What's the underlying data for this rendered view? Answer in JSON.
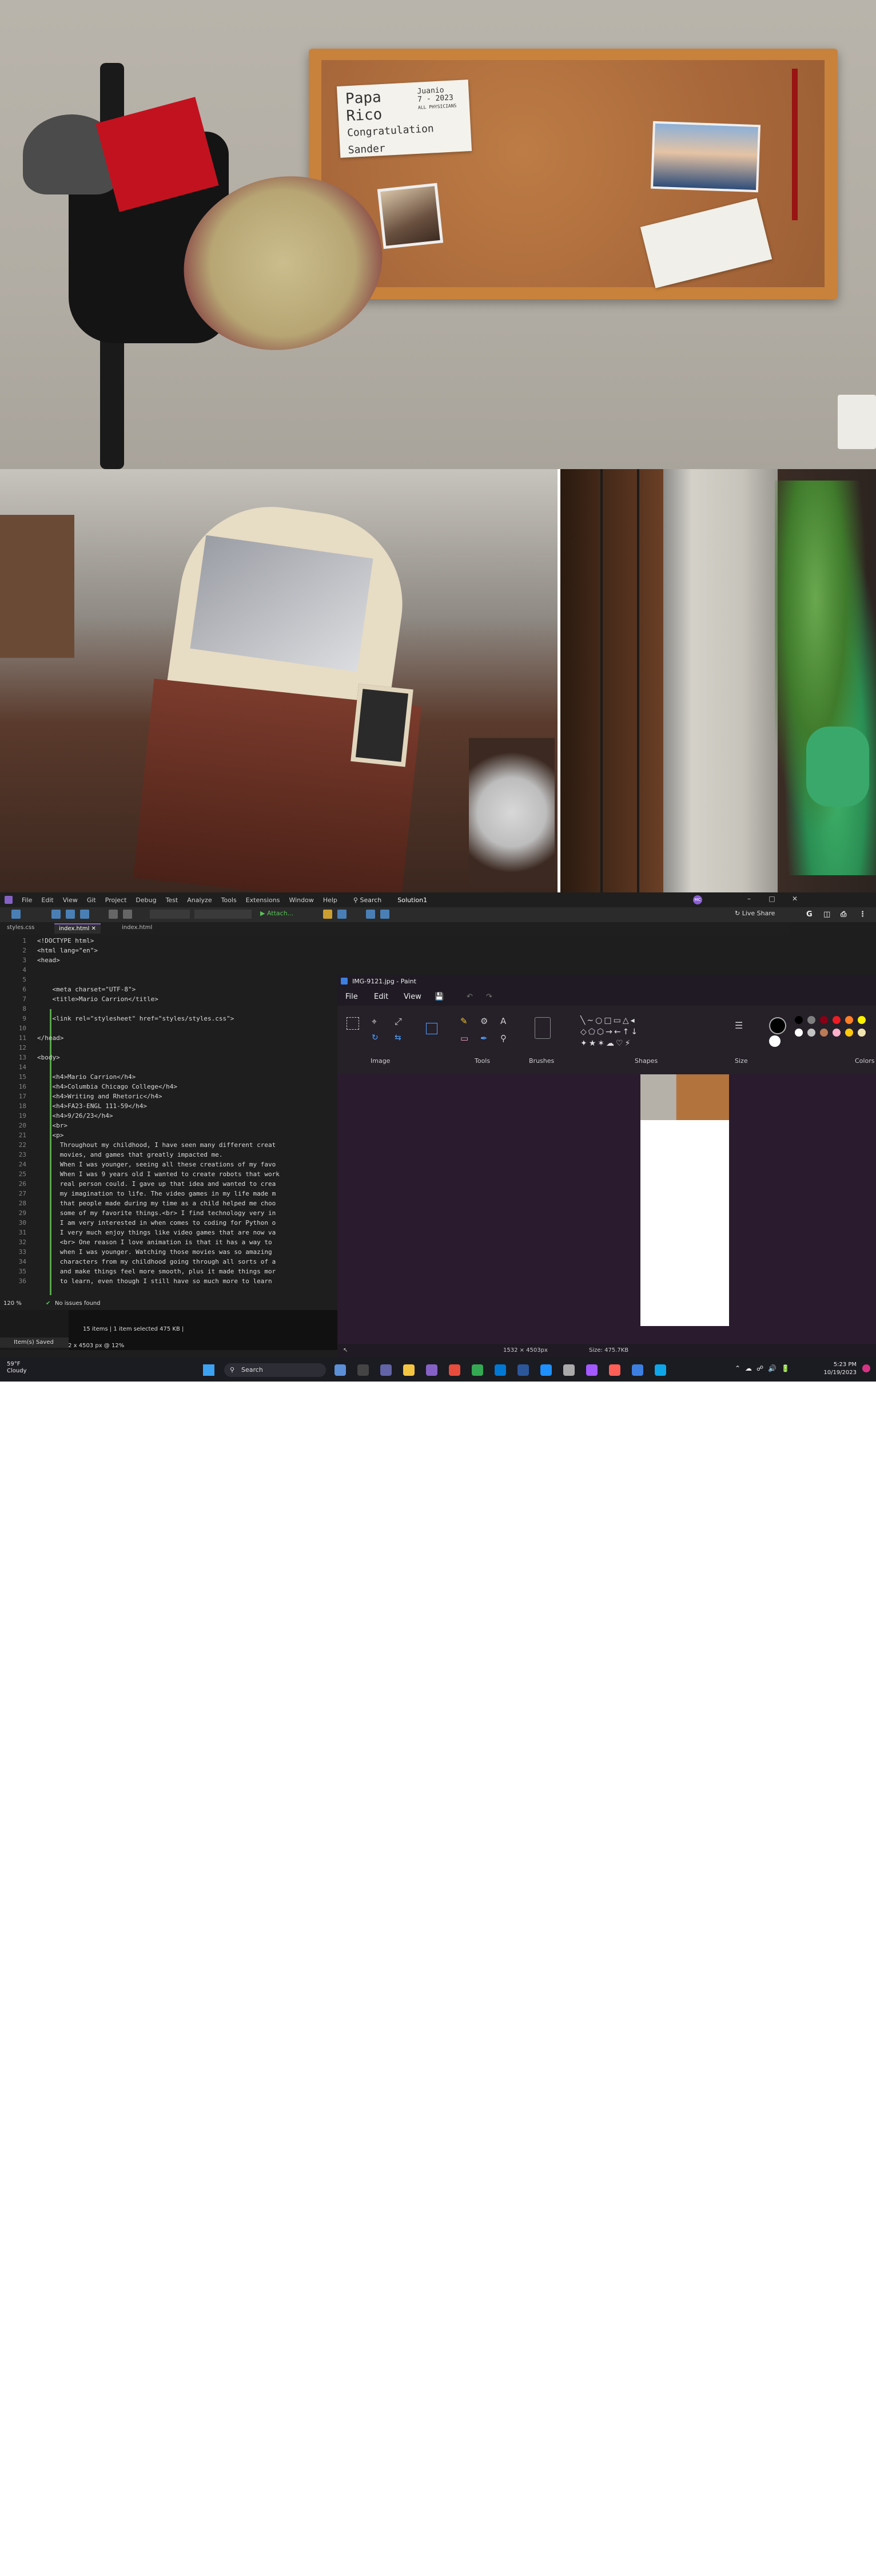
{
  "wall_photo": {
    "note_text_lines": [
      "Papa",
      "Rico",
      "Congratulation",
      "Sander"
    ],
    "note_small_text": [
      "Juanio",
      "7 - 2023",
      "ALL PHYSICIANS"
    ]
  },
  "visual_studio": {
    "menu": [
      "File",
      "Edit",
      "View",
      "Git",
      "Project",
      "Debug",
      "Test",
      "Analyze",
      "Tools",
      "Extensions",
      "Window",
      "Help"
    ],
    "search_label": "Search",
    "solution_name": "Solution1",
    "avatar_initials": "MC",
    "toolbar_attach": "Attach...",
    "live_share": "Live Share",
    "tabs": [
      "styles.css",
      "index.html",
      "index.html"
    ],
    "code_lines": [
      "<!DOCTYPE html>",
      "<html lang=\"en\">",
      "<head>",
      "",
      "",
      "    <meta charset=\"UTF-8\">",
      "    <title>Mario Carrion</title>",
      "",
      "    <link rel=\"stylesheet\" href=\"styles/styles.css\">",
      "",
      "</head>",
      "",
      "<body>",
      "",
      "    <h4>Mario Carrion</h4>",
      "    <h4>Columbia Chicago College</h4>",
      "    <h4>Writing and Rhetoric</h4>",
      "    <h4>FA23-ENGL 111-59</h4>",
      "    <h4>9/26/23</h4>",
      "    <br>",
      "    <p>",
      "      Throughout my childhood, I have seen many different creat",
      "      movies, and games that greatly impacted me.",
      "      When I was younger, seeing all these creations of my favo",
      "      When I was 9 years old I wanted to create robots that work",
      "      real person could. I gave up that idea and wanted to crea",
      "      my imagination to life. The video games in my life made m",
      "      that people made during my time as a child helped me choo",
      "      some of my favorite things.<br> I find technology very in",
      "      I am very interested in when comes to coding for Python o",
      "      I very much enjoy things like video games that are now va",
      "      <br> One reason I love animation is that it has a way to",
      "      when I was younger. Watching those movies was so amazing",
      "      characters from my childhood going through all sorts of a",
      "      and make things feel more smooth, plus it made things mor",
      "      to learn, even though I still have so much more to learn"
    ],
    "status_zoom": "120 %",
    "status_issues": "No issues found",
    "status_bar": "Item(s) Saved",
    "explorer_items": "15 items  |  1 item selected  475 KB  |",
    "explorer_dims": "1532 x 4503 px @ 12%"
  },
  "paint": {
    "title": "IMG-9121.jpg - Paint",
    "menu": [
      "File",
      "Edit",
      "View"
    ],
    "groups": [
      "Image",
      "Tools",
      "Brushes",
      "Shapes",
      "Size",
      "Colors"
    ],
    "status_pos": "1532 × 4503px",
    "status_size": "Size: 475.7KB",
    "palette": [
      "#000000",
      "#7f7f7f",
      "#880015",
      "#ed1c24",
      "#ff7f27",
      "#fff200",
      "#ffffff",
      "#c3c3c3",
      "#b97a57",
      "#ffaec9",
      "#ffc90e",
      "#efe4b0"
    ]
  },
  "taskbar": {
    "weather_temp": "59°F",
    "weather_desc": "Cloudy",
    "search": "Search",
    "time": "5:23 PM",
    "date": "10/19/2023"
  }
}
